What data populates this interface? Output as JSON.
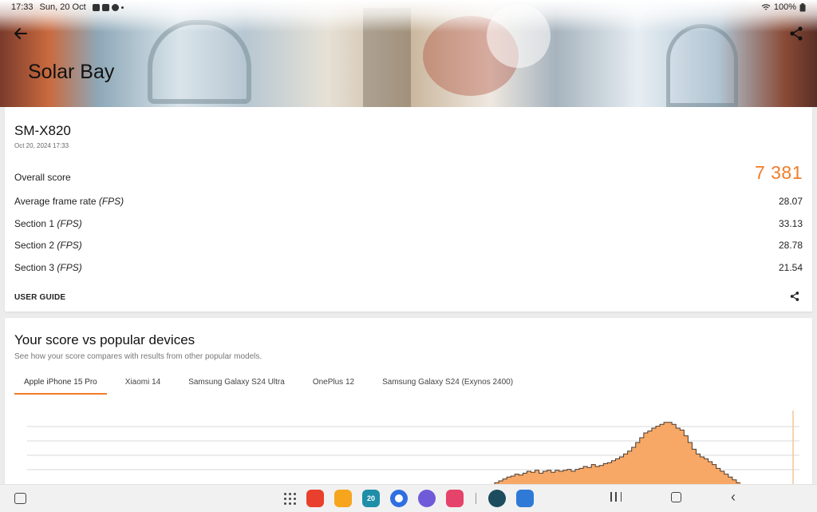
{
  "status": {
    "time": "17:33",
    "date": "Sun, 20 Oct",
    "battery": "100%"
  },
  "header": {
    "title": "Solar Bay"
  },
  "result": {
    "device": "SM-X820",
    "date": "Oct 20, 2024 17:33",
    "overall_label": "Overall score",
    "overall_value": "7 381",
    "rows": [
      {
        "label": "Average frame rate",
        "unit": "(FPS)",
        "value": "28.07"
      },
      {
        "label": "Section 1",
        "unit": "(FPS)",
        "value": "33.13"
      },
      {
        "label": "Section 2",
        "unit": "(FPS)",
        "value": "28.78"
      },
      {
        "label": "Section 3",
        "unit": "(FPS)",
        "value": "21.54"
      }
    ],
    "user_guide": "USER GUIDE"
  },
  "compare": {
    "title": "Your score vs popular devices",
    "subtitle": "See how your score compares with results from other popular models.",
    "tabs": [
      "Apple iPhone 15 Pro",
      "Xiaomi 14",
      "Samsung Galaxy S24 Ultra",
      "OnePlus 12",
      "Samsung Galaxy S24 (Exynos 2400)"
    ],
    "active_tab": 0
  },
  "chart_data": {
    "type": "area",
    "title": "",
    "xlabel": "",
    "ylabel": "",
    "color": "#f7a866",
    "values": [
      3,
      5,
      7,
      9,
      10,
      12,
      11,
      13,
      15,
      14,
      16,
      13,
      15,
      16,
      14,
      16,
      15,
      16,
      17,
      15,
      17,
      18,
      20,
      19,
      22,
      20,
      21,
      23,
      24,
      26,
      28,
      30,
      33,
      36,
      40,
      45,
      50,
      55,
      57,
      60,
      62,
      64,
      66,
      66,
      64,
      60,
      58,
      52,
      45,
      38,
      33,
      30,
      28,
      25,
      22,
      18,
      15,
      12,
      9,
      6,
      3
    ]
  },
  "nav": {
    "apps": [
      "apps-grid-icon",
      "notes-app-icon",
      "files-app-icon",
      "calendar-app-icon",
      "messages-app-icon",
      "internet-app-icon",
      "screen-recorder-app-icon",
      "snowflake-app-icon",
      "multi-window-app-icon"
    ],
    "calendar_day": "20"
  }
}
